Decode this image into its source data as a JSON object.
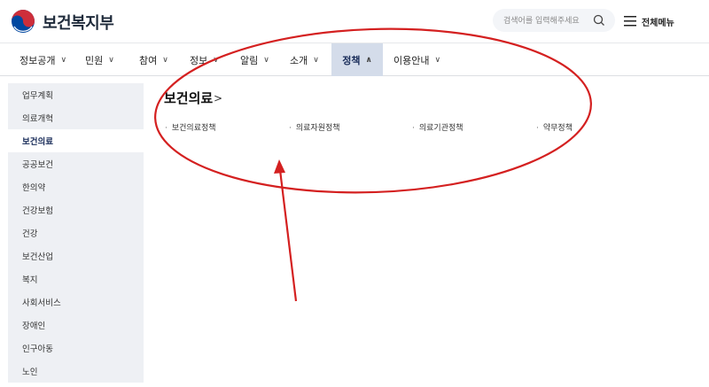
{
  "header": {
    "brand": "보건복지부",
    "search_placeholder": "검색어를 입력해주세요",
    "menu_label": "전체메뉴",
    "icons": {
      "logo": "taegeuk-logo-icon",
      "search": "search-icon",
      "menu": "hamburger-icon"
    }
  },
  "nav": {
    "items": [
      {
        "label": "정보공개",
        "chevron": "∨"
      },
      {
        "label": "민원",
        "chevron": "∨"
      },
      {
        "label": "참여",
        "chevron": "∨"
      },
      {
        "label": "정보",
        "chevron": "∨"
      },
      {
        "label": "알림",
        "chevron": "∨"
      },
      {
        "label": "소개",
        "chevron": "∨"
      },
      {
        "label": "정책",
        "chevron": "∧"
      },
      {
        "label": "이용안내",
        "chevron": "∨"
      }
    ],
    "active_index": 6
  },
  "sidebar": {
    "items": [
      {
        "label": "업무계획"
      },
      {
        "label": "의료개혁"
      },
      {
        "label": "보건의료"
      },
      {
        "label": "공공보건"
      },
      {
        "label": "한의약"
      },
      {
        "label": "건강보험"
      },
      {
        "label": "건강"
      },
      {
        "label": "보건산업"
      },
      {
        "label": "복지"
      },
      {
        "label": "사회서비스"
      },
      {
        "label": "장애인"
      },
      {
        "label": "인구아동"
      },
      {
        "label": "노인"
      }
    ],
    "active_index": 2
  },
  "main": {
    "title": "보건의료",
    "title_chevron": ">",
    "sub_links": [
      {
        "label": "보건의료정책"
      },
      {
        "label": "의료자원정책"
      },
      {
        "label": "의료기관정책"
      },
      {
        "label": "약무정책"
      }
    ]
  },
  "colors": {
    "accent_active": "#d4dcea",
    "annotation": "#d42020",
    "logo_red": "#cd2e3a",
    "logo_blue": "#0047a0"
  }
}
